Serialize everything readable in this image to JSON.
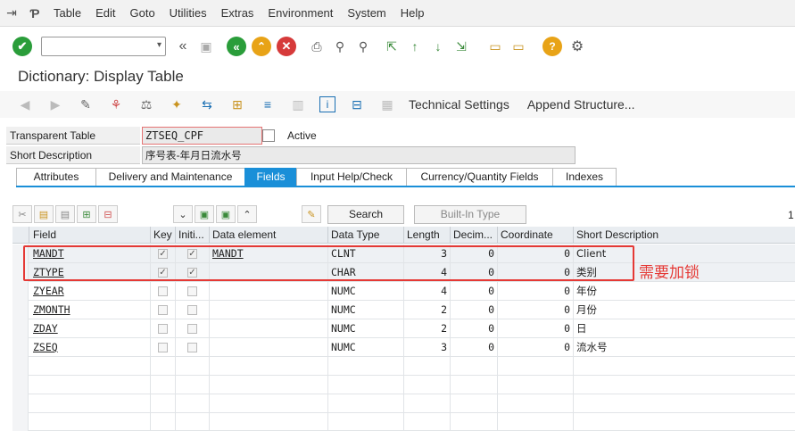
{
  "menu": {
    "items": [
      "Table",
      "Edit",
      "Goto",
      "Utilities",
      "Extras",
      "Environment",
      "System",
      "Help"
    ]
  },
  "title": "Dictionary: Display Table",
  "toolbar2": {
    "technical_settings": "Technical Settings",
    "append_structure": "Append Structure..."
  },
  "header": {
    "table_label": "Transparent Table",
    "table_name": "ZTSEQ_CPF",
    "status": "Active",
    "short_desc_label": "Short Description",
    "short_desc": "序号表-年月日流水号"
  },
  "tabs": [
    "Attributes",
    "Delivery and Maintenance",
    "Fields",
    "Input Help/Check",
    "Currency/Quantity Fields",
    "Indexes"
  ],
  "grid_toolbar": {
    "search": "Search",
    "builtin_type": "Built-In Type",
    "page": "1"
  },
  "columns": [
    "Field",
    "Key",
    "Initi...",
    "Data element",
    "Data Type",
    "Length",
    "Decim...",
    "Coordinate",
    "Short Description"
  ],
  "rows": [
    {
      "field": "MANDT",
      "key": true,
      "initial": true,
      "data_element": "MANDT",
      "data_type": "CLNT",
      "length": "3",
      "decimals": "0",
      "coordinate": "0",
      "short_desc": "Client"
    },
    {
      "field": "ZTYPE",
      "key": true,
      "initial": true,
      "data_element": "",
      "data_type": "CHAR",
      "length": "4",
      "decimals": "0",
      "coordinate": "0",
      "short_desc": "类别"
    },
    {
      "field": "ZYEAR",
      "key": false,
      "initial": false,
      "data_element": "",
      "data_type": "NUMC",
      "length": "4",
      "decimals": "0",
      "coordinate": "0",
      "short_desc": "年份"
    },
    {
      "field": "ZMONTH",
      "key": false,
      "initial": false,
      "data_element": "",
      "data_type": "NUMC",
      "length": "2",
      "decimals": "0",
      "coordinate": "0",
      "short_desc": "月份"
    },
    {
      "field": "ZDAY",
      "key": false,
      "initial": false,
      "data_element": "",
      "data_type": "NUMC",
      "length": "2",
      "decimals": "0",
      "coordinate": "0",
      "short_desc": "日"
    },
    {
      "field": "ZSEQ",
      "key": false,
      "initial": false,
      "data_element": "",
      "data_type": "NUMC",
      "length": "3",
      "decimals": "0",
      "coordinate": "0",
      "short_desc": "流水号"
    }
  ],
  "annotation": "需要加锁",
  "colors": {
    "accent": "#1a8fd8",
    "annotation_red": "#e53935"
  }
}
